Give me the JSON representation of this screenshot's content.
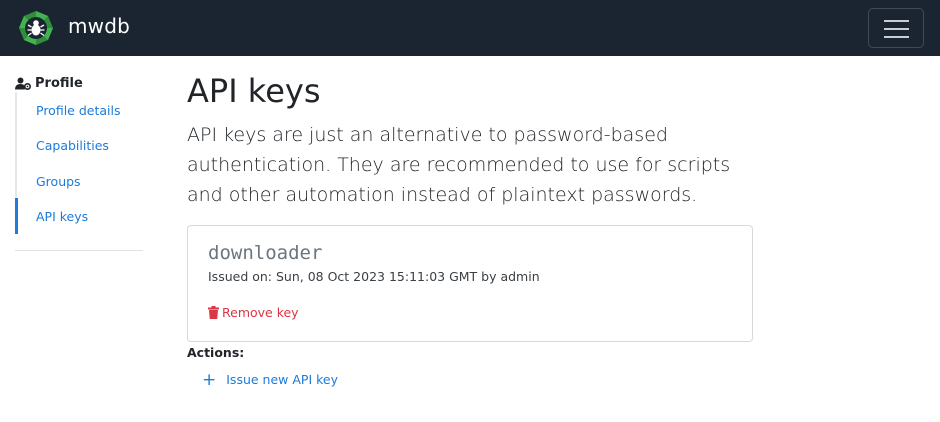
{
  "navbar": {
    "brand": "mwdb",
    "logo_icon": "bug-logo-icon",
    "menu_icon": "hamburger-menu-icon",
    "bg_color": "#1b2532"
  },
  "sidebar": {
    "header": "Profile",
    "header_icon": "user-settings-icon",
    "items": [
      {
        "label": "Profile details",
        "active": false
      },
      {
        "label": "Capabilities",
        "active": false
      },
      {
        "label": "Groups",
        "active": false
      },
      {
        "label": "API keys",
        "active": true
      }
    ]
  },
  "main": {
    "title": "API keys",
    "lead": "API keys are just an alternative to password-based authentication. They are recommended to use for scripts and other automation instead of plaintext passwords.",
    "keys": [
      {
        "name": "downloader",
        "issued": "Issued on: Sun, 08 Oct 2023 15:11:03 GMT by admin",
        "remove_label": "Remove key",
        "remove_icon": "trash-icon"
      }
    ],
    "actions_label": "Actions:",
    "issue_button": {
      "label": "Issue new API key",
      "icon": "plus-icon"
    }
  },
  "colors": {
    "accent": "#1c7bdc",
    "danger": "#dc3545"
  }
}
